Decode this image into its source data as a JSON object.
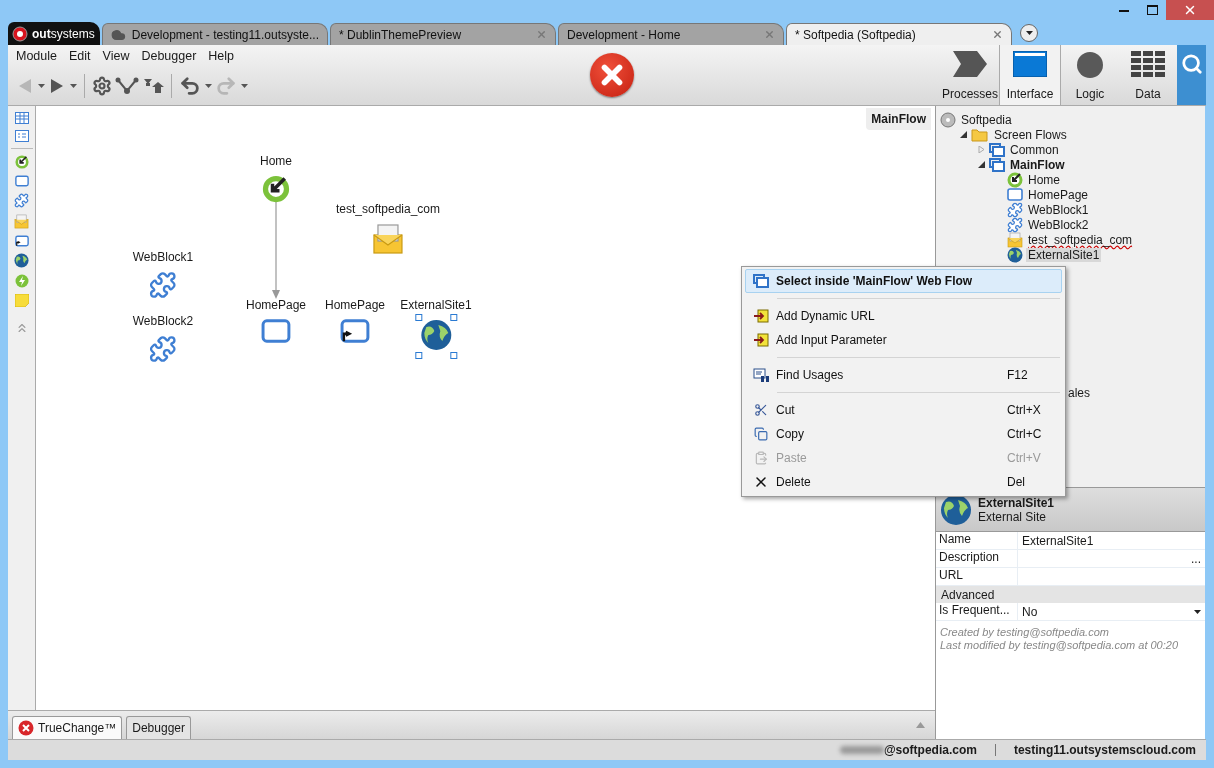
{
  "logo": "**out**systems",
  "tabs": [
    {
      "label": "Development - testing11.outsyste...",
      "cloud": true,
      "closable": false,
      "selected": false
    },
    {
      "label": "* DublinThemePreview",
      "cloud": false,
      "closable": true,
      "selected": false
    },
    {
      "label": "Development - Home",
      "cloud": false,
      "closable": true,
      "selected": false
    },
    {
      "label": "* Softpedia (Softpedia)",
      "cloud": false,
      "closable": true,
      "selected": true
    }
  ],
  "menu": [
    "Module",
    "Edit",
    "View",
    "Debugger",
    "Help"
  ],
  "toolbar": [
    {
      "kind": "back",
      "disabled": true
    },
    {
      "kind": "caret",
      "disabled": false
    },
    {
      "kind": "run",
      "disabled": false
    },
    {
      "kind": "caret",
      "disabled": false
    },
    {
      "kind": "sep"
    },
    {
      "kind": "gear",
      "disabled": false
    },
    {
      "kind": "compare",
      "disabled": false
    },
    {
      "kind": "merge",
      "disabled": false
    },
    {
      "kind": "sep"
    },
    {
      "kind": "undo",
      "disabled": false
    },
    {
      "kind": "caret",
      "disabled": false
    },
    {
      "kind": "redo",
      "disabled": true
    },
    {
      "kind": "caret",
      "disabled": false
    }
  ],
  "layers": [
    {
      "label": "Processes",
      "kind": "processes",
      "selected": false
    },
    {
      "label": "Interface",
      "kind": "interface",
      "selected": true
    },
    {
      "label": "Logic",
      "kind": "logic",
      "selected": false
    },
    {
      "label": "Data",
      "kind": "data",
      "selected": false
    }
  ],
  "canvas": {
    "flow_label": "MainFlow",
    "nodes": [
      {
        "kind": "entry",
        "label": "Home",
        "selected": false
      },
      {
        "kind": "email",
        "label": "test_softpedia_com",
        "selected": false
      },
      {
        "kind": "block",
        "label": "WebBlock1",
        "selected": false
      },
      {
        "kind": "block",
        "label": "WebBlock2",
        "selected": false
      },
      {
        "kind": "screen",
        "label": "HomePage",
        "selected": false
      },
      {
        "kind": "screenlink",
        "label": "HomePage",
        "selected": false
      },
      {
        "kind": "globe",
        "label": "ExternalSite1",
        "selected": true
      }
    ]
  },
  "tree": {
    "label": "Softpedia",
    "kind": "root",
    "children": [
      {
        "label": "Screen Flows",
        "kind": "folder",
        "expanded": true,
        "children": [
          {
            "label": "Common",
            "kind": "flow",
            "expanded": false,
            "active": false
          },
          {
            "label": "MainFlow",
            "kind": "flow",
            "expanded": true,
            "active": true,
            "children": [
              {
                "label": "Home",
                "kind": "entry",
                "selected": false,
                "warning": false
              },
              {
                "label": "HomePage",
                "kind": "screen",
                "selected": false,
                "warning": false
              },
              {
                "label": "WebBlock1",
                "kind": "block",
                "selected": false,
                "warning": false
              },
              {
                "label": "WebBlock2",
                "kind": "block",
                "selected": false,
                "warning": false
              },
              {
                "label": "test_softpedia_com",
                "kind": "email",
                "selected": false,
                "warning": true
              },
              {
                "label": "ExternalSite1",
                "kind": "globe",
                "selected": true,
                "warning": false
              }
            ]
          }
        ]
      }
    ]
  },
  "tree_covered_label": "ales",
  "context_menu": {
    "groups": [
      {
        "items": [
          {
            "kind": "flow",
            "label": "Select inside 'MainFlow' Web Flow",
            "highlighted": true,
            "disabled": false
          }
        ]
      },
      {
        "items": [
          {
            "kind": "arrow",
            "label": "Add Dynamic URL",
            "highlighted": false,
            "disabled": false
          },
          {
            "kind": "arrow",
            "label": "Add Input Parameter",
            "highlighted": false,
            "disabled": false
          }
        ]
      },
      {
        "items": [
          {
            "kind": "find",
            "label": "Find Usages",
            "shortcut": "F12",
            "highlighted": false,
            "disabled": false
          }
        ]
      },
      {
        "items": [
          {
            "kind": "cut",
            "label": "Cut",
            "shortcut": "Ctrl+X",
            "highlighted": false,
            "disabled": false
          },
          {
            "kind": "copy",
            "label": "Copy",
            "shortcut": "Ctrl+C",
            "highlighted": false,
            "disabled": false
          },
          {
            "kind": "paste",
            "label": "Paste",
            "shortcut": "Ctrl+V",
            "highlighted": false,
            "disabled": true
          },
          {
            "kind": "delete",
            "label": "Delete",
            "shortcut": "Del",
            "highlighted": false,
            "disabled": false
          }
        ]
      }
    ]
  },
  "properties": {
    "title": "ExternalSite1",
    "subtitle": "External Site",
    "rows": [
      {
        "kind": "field",
        "label": "Name",
        "value": "ExternalSite1"
      },
      {
        "kind": "field",
        "label": "Description",
        "button": "..."
      },
      {
        "kind": "field",
        "label": "URL"
      },
      {
        "kind": "section",
        "label": "Advanced"
      },
      {
        "kind": "dropdown",
        "label": "Is Frequent...",
        "value": "No"
      }
    ],
    "footer": [
      "Created by testing@softpedia.com",
      "Last modified by testing@softpedia.com at 00:20"
    ]
  },
  "bottom_tabs": [
    {
      "label": "TrueChange™",
      "kind": "error",
      "selected": true
    },
    {
      "label": "Debugger",
      "kind": "plain",
      "selected": false
    }
  ],
  "status_bar": {
    "user": "@softpedia.com",
    "server": "testing11.outsystemscloud.com"
  }
}
